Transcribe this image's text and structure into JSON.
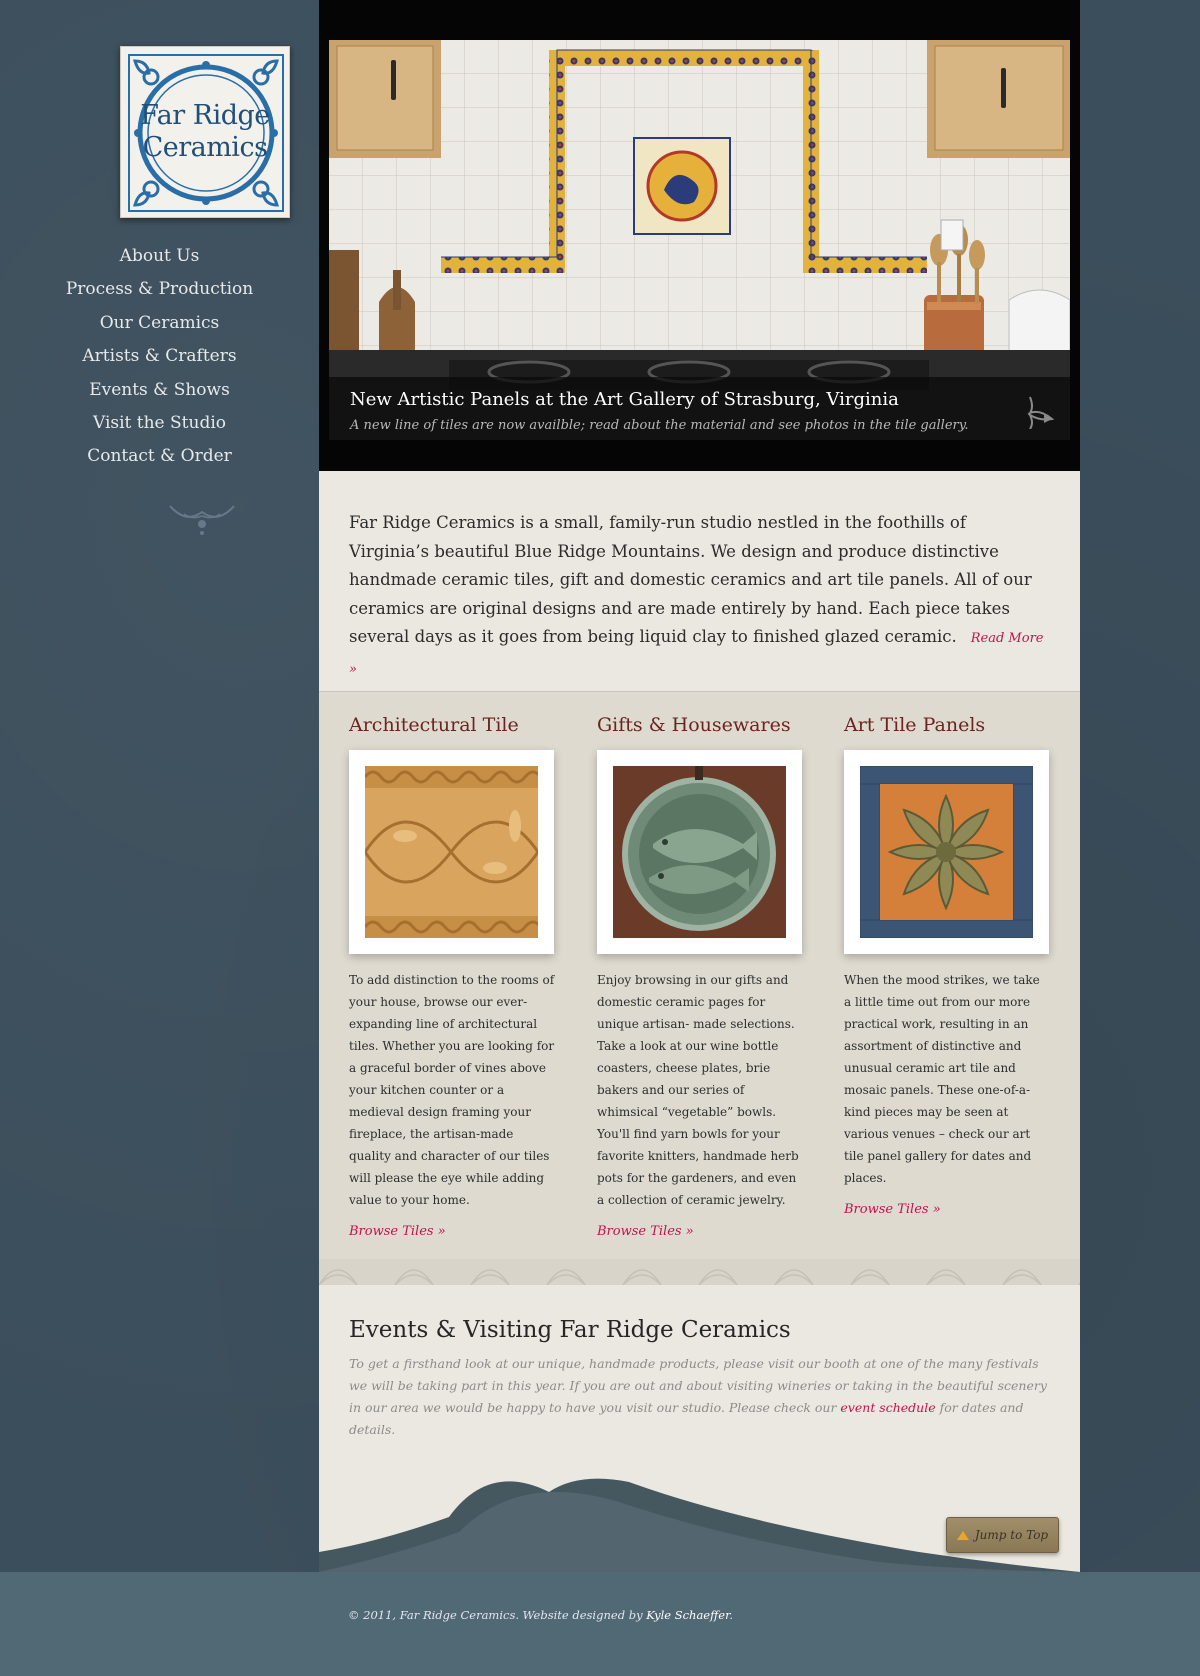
{
  "logo": {
    "line1": "Far Ridge",
    "line2": "Ceramics"
  },
  "nav": {
    "items": [
      "About Us",
      "Process & Production",
      "Our Ceramics",
      "Artists & Crafters",
      "Events & Shows",
      "Visit the Studio",
      "Contact & Order"
    ]
  },
  "hero": {
    "title": "New Artistic Panels at the Art Gallery of Strasburg, Virginia",
    "subtitle": "A new line of tiles are now availble; read about the material and see photos in the tile gallery."
  },
  "intro": {
    "text": "Far Ridge Ceramics is a small, family-run studio nestled in the foothills of Virginia’s beautiful Blue Ridge Mountains.  We design and produce distinctive handmade ceramic tiles, gift and domestic ceramics and art tile panels.  All of our ceramics are original designs and are made entirely by hand.  Each piece takes several days as it goes from being liquid clay to finished glazed ceramic.",
    "read_more": "Read More »"
  },
  "features": [
    {
      "title": "Architectural Tile",
      "text": "To add distinction to the rooms of your house, browse our ever-expanding line of architectural tiles.  Whether you are looking for a graceful border of vines above your kitchen counter or a medieval design framing your fireplace, the artisan-made quality and character of our tiles will please the eye while adding value to your home.",
      "link": "Browse Tiles »"
    },
    {
      "title": "Gifts & Housewares",
      "text": "Enjoy browsing in our gifts and domestic ceramic pages for unique artisan- made selections.  Take a look at our wine bottle coasters, cheese plates, brie bakers and our series of whimsical “vegetable” bowls.  You'll find yarn bowls for your favorite knitters, handmade herb pots for the gardeners, and even a collection of ceramic jewelry.",
      "link": "Browse Tiles »"
    },
    {
      "title": "Art Tile Panels",
      "text": "When the mood strikes, we take a little time out from our more practical work, resulting in an assortment of distinctive and unusual ceramic art tile and mosaic panels.  These one-of-a-kind pieces may be seen at various venues – check our art tile panel gallery for dates and places.",
      "link": "Browse Tiles »"
    }
  ],
  "events": {
    "title": "Events & Visiting Far Ridge Ceramics",
    "text_before": "To get a firsthand look at our unique, handmade products, please visit our booth at one of the many festivals we will be taking part in this year.  If you are out and about visiting wineries or taking in the beautiful scenery in our area we would be happy to have you visit our studio.  Please check our ",
    "link": "event schedule",
    "text_after": " for dates and details."
  },
  "jump_top": "Jump to Top",
  "footer": {
    "copyright": "© 2011, Far Ridge Ceramics.  Website designed by ",
    "designer": "Kyle Schaeffer",
    "period": "."
  },
  "colors": {
    "background": "#3b4e5b",
    "accent_link": "#c0144f",
    "heading_red": "#6b2420",
    "footer": "#516875",
    "logo_blue": "#1f4f7a"
  }
}
